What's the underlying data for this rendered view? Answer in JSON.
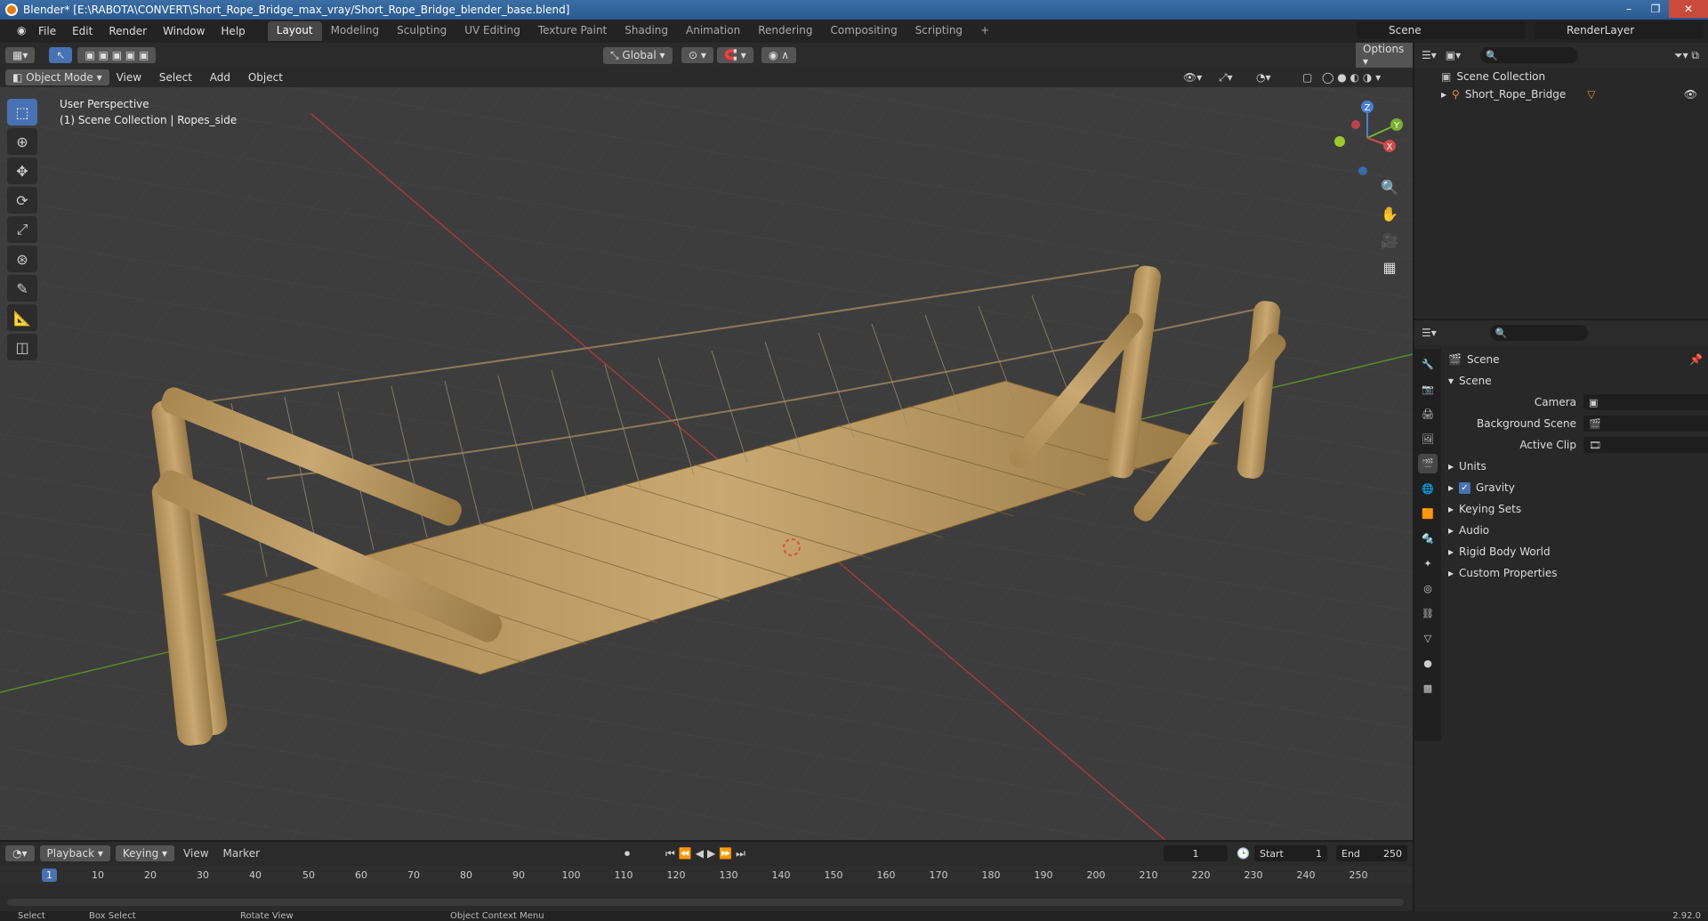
{
  "window": {
    "title": "Blender* [E:\\RABOTA\\CONVERT\\Short_Rope_Bridge_max_vray/Short_Rope_Bridge_blender_base.blend]"
  },
  "menu": [
    "File",
    "Edit",
    "Render",
    "Window",
    "Help"
  ],
  "workspaces": [
    "Layout",
    "Modeling",
    "Sculpting",
    "UV Editing",
    "Texture Paint",
    "Shading",
    "Animation",
    "Rendering",
    "Compositing",
    "Scripting"
  ],
  "active_workspace": "Layout",
  "scene_name": "Scene",
  "render_layer": "RenderLayer",
  "viewport": {
    "mode": "Object Mode",
    "menus": [
      "View",
      "Select",
      "Add",
      "Object"
    ],
    "orientation": "Global",
    "options": "Options",
    "perspective": "User Perspective",
    "collection_info": "(1) Scene Collection | Ropes_side",
    "axis_labels": {
      "x": "X",
      "y": "Y",
      "z": "Z"
    }
  },
  "outliner": {
    "root": "Scene Collection",
    "items": [
      "Short_Rope_Bridge"
    ]
  },
  "properties": {
    "context": "Scene",
    "panel": "Scene",
    "fields": [
      {
        "label": "Camera",
        "value": ""
      },
      {
        "label": "Background Scene",
        "value": ""
      },
      {
        "label": "Active Clip",
        "value": ""
      }
    ],
    "sections": [
      "Units",
      "Gravity",
      "Keying Sets",
      "Audio",
      "Rigid Body World",
      "Custom Properties"
    ],
    "gravity_checked": true
  },
  "timeline": {
    "menus": [
      "Playback",
      "Keying",
      "View",
      "Marker"
    ],
    "current_frame": "1",
    "start_label": "Start",
    "start": "1",
    "end_label": "End",
    "end": "250",
    "ticks": [
      "10",
      "20",
      "30",
      "40",
      "50",
      "60",
      "70",
      "80",
      "90",
      "100",
      "110",
      "120",
      "130",
      "140",
      "150",
      "160",
      "170",
      "180",
      "190",
      "200",
      "210",
      "220",
      "230",
      "240",
      "250"
    ],
    "playhead_label": "1"
  },
  "status": {
    "select": "Select",
    "box_select": "Box Select",
    "rotate_view": "Rotate View",
    "context_menu": "Object Context Menu",
    "version": "2.92.0"
  }
}
